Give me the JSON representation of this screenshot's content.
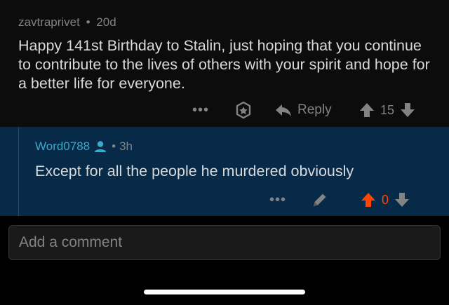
{
  "top_comment": {
    "author": "zavtraprivet",
    "separator": "•",
    "age": "20d",
    "body": "Happy 141st Birthday to Stalin, just hoping that you continue to contribute to the lives of others with your spirit and hope for a better life for everyone.",
    "more_label": "•••",
    "reply_label": "Reply",
    "score": "15"
  },
  "reply_comment": {
    "author": "Word0788",
    "separator": "•",
    "age": "3h",
    "body": "Except for all the people he murdered obviously",
    "more_label": "•••",
    "score": "0",
    "upvote_color": "#ff4500"
  },
  "composer": {
    "placeholder": "Add a comment"
  },
  "colors": {
    "background": "#000000",
    "reply_background": "#062a47",
    "author_accent": "#3ba9c9",
    "muted": "#818384"
  }
}
